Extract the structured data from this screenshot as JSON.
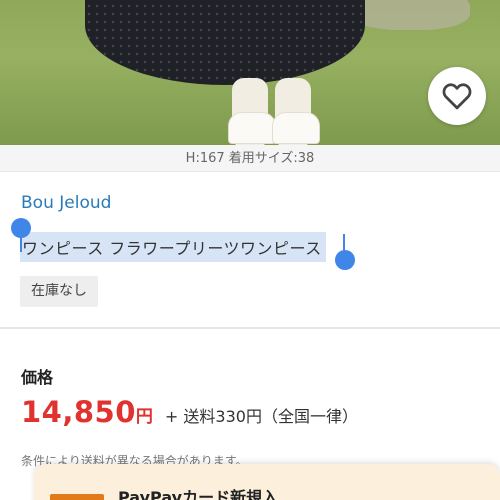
{
  "product_image": {
    "caption": "H:167 着用サイズ:38"
  },
  "favorite": {
    "icon": "heart-outline-icon"
  },
  "product": {
    "brand": "Bou Jeloud",
    "title": "ワンピース フラワープリーツワンピース",
    "stock_status": "在庫なし"
  },
  "price": {
    "label": "価格",
    "amount": "14,850",
    "currency": "円",
    "shipping": "+ 送料330円（全国一律）",
    "note": "条件により送料が異なる場合があります。"
  },
  "promo": {
    "text": "PayPayカード新規入…"
  },
  "colors": {
    "link": "#2a7ab8",
    "price": "#e0332f",
    "selection": "#3f86e8",
    "promo_bg": "#fcefdc"
  }
}
